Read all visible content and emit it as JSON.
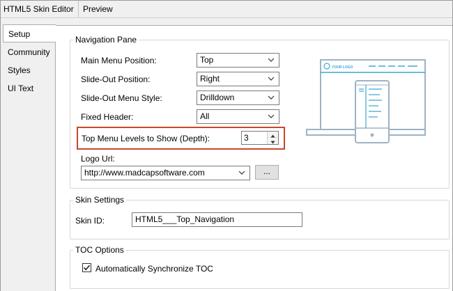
{
  "window": {
    "tabs": [
      "HTML5 Skin Editor",
      "Preview"
    ]
  },
  "sidebar": {
    "items": [
      {
        "label": "Setup",
        "active": true
      },
      {
        "label": "Community",
        "active": false
      },
      {
        "label": "Styles",
        "active": false
      },
      {
        "label": "UI Text",
        "active": false
      }
    ]
  },
  "navigation_pane": {
    "title": "Navigation Pane",
    "main_menu_position": {
      "label": "Main Menu Position:",
      "value": "Top"
    },
    "slide_out_position": {
      "label": "Slide-Out Position:",
      "value": "Right"
    },
    "slide_out_menu_style": {
      "label": "Slide-Out Menu Style:",
      "value": "Drilldown"
    },
    "fixed_header": {
      "label": "Fixed Header:",
      "value": "All"
    },
    "top_menu_levels": {
      "label": "Top Menu Levels to Show (Depth):",
      "value": "3"
    },
    "logo_url": {
      "label": "Logo Url:",
      "value": "http://www.madcapsoftware.com",
      "browse_label": "..."
    },
    "preview_logo_text": "YOUR LOGO"
  },
  "skin_settings": {
    "title": "Skin Settings",
    "skin_id": {
      "label": "Skin ID:",
      "value": "HTML5___Top_Navigation"
    }
  },
  "toc_options": {
    "title": "TOC Options",
    "auto_sync": {
      "label": "Automatically Synchronize TOC",
      "checked": true
    }
  },
  "colors": {
    "highlight_border": "#c8472b",
    "illustration_accent": "#3aa7d0",
    "illustration_line": "#9db3c4"
  }
}
